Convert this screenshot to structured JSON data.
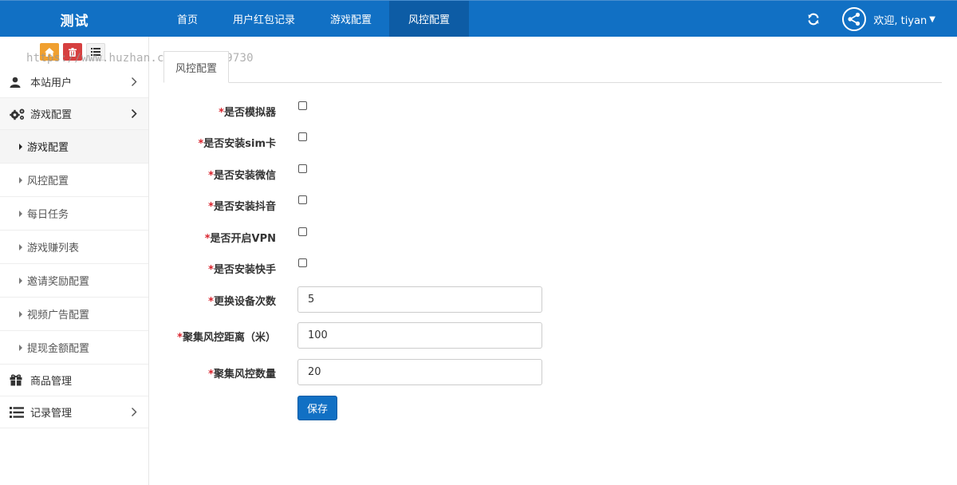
{
  "header": {
    "brand": "测试",
    "nav": [
      {
        "label": "首页"
      },
      {
        "label": "用户红包记录"
      },
      {
        "label": "游戏配置"
      },
      {
        "label": "风控配置"
      }
    ],
    "active_nav_index": 3,
    "welcome": "欢迎, tiyan",
    "refresh_icon": "refresh-icon",
    "avatar_icon": "share-icon"
  },
  "sidebar": {
    "shortcuts": [
      {
        "icon": "home-icon",
        "color": "#f0a030"
      },
      {
        "icon": "trash-icon",
        "color": "#d64040"
      },
      {
        "icon": "list-icon",
        "color": "#f2f2f2"
      }
    ],
    "watermark": "https://www.huzhan.com/ishop49730",
    "menu": [
      {
        "label": "本站用户",
        "icon": "user-icon"
      },
      {
        "label": "游戏配置",
        "icon": "gears-icon"
      },
      {
        "label": "商品管理",
        "icon": "gift-icon"
      },
      {
        "label": "记录管理",
        "icon": "list-icon"
      }
    ],
    "submenu": [
      {
        "label": "游戏配置"
      },
      {
        "label": "风控配置"
      },
      {
        "label": "每日任务"
      },
      {
        "label": "游戏赚列表"
      },
      {
        "label": "邀请奖励配置"
      },
      {
        "label": "视频广告配置"
      },
      {
        "label": "提现金额配置"
      }
    ]
  },
  "content": {
    "tab": "风控配置",
    "required_mark": "*",
    "checkbox_fields": [
      {
        "label": "是否模拟器"
      },
      {
        "label": "是否安装sim卡"
      },
      {
        "label": "是否安装微信"
      },
      {
        "label": "是否安装抖音"
      },
      {
        "label": "是否开启VPN"
      },
      {
        "label": "是否安装快手"
      }
    ],
    "input_fields": [
      {
        "label": "更换设备次数",
        "value": "5"
      },
      {
        "label": "聚集风控距离（米）",
        "value": "100"
      },
      {
        "label": "聚集风控数量",
        "value": "20"
      }
    ],
    "save_label": "保存"
  },
  "colors": {
    "primary": "#1170c4",
    "primary_dark": "#0d5ca5",
    "required": "#d9232d"
  }
}
